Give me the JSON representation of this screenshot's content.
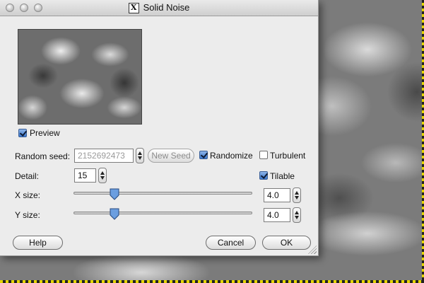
{
  "window": {
    "title": "Solid Noise"
  },
  "preview": {
    "label": "Preview",
    "checked": true
  },
  "seed": {
    "label": "Random seed:",
    "value": "2152692473",
    "new_seed_label": "New Seed"
  },
  "randomize": {
    "label": "Randomize",
    "checked": true
  },
  "turbulent": {
    "label": "Turbulent",
    "checked": false
  },
  "detail": {
    "label": "Detail:",
    "value": "15"
  },
  "tilable": {
    "label": "Tilable",
    "checked": true
  },
  "x_size": {
    "label": "X size:",
    "value": "4.0",
    "slider_fraction": 0.23
  },
  "y_size": {
    "label": "Y size:",
    "value": "4.0",
    "slider_fraction": 0.23
  },
  "buttons": {
    "help": "Help",
    "cancel": "Cancel",
    "ok": "OK"
  },
  "colors": {
    "accent": "#3c78cc",
    "canvas_border": "#e4d400"
  },
  "icons": {
    "app_icon": "x11-icon",
    "thumb": "slider-thumb-icon"
  }
}
